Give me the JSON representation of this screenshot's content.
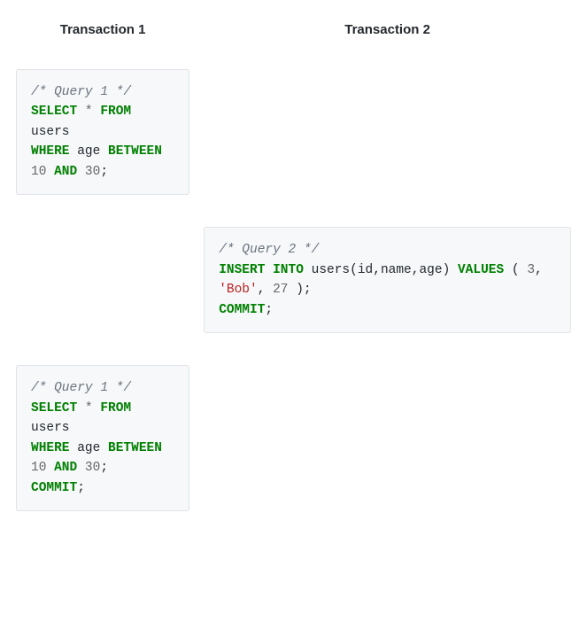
{
  "headers": {
    "col1": "Transaction 1",
    "col2": "Transaction 2"
  },
  "rows": [
    {
      "col1": {
        "tokens": [
          {
            "t": "/* Query 1 */",
            "c": "c-comment"
          },
          {
            "t": "\n"
          },
          {
            "t": "SELECT",
            "c": "c-keyword"
          },
          {
            "t": " "
          },
          {
            "t": "*",
            "c": "c-op"
          },
          {
            "t": " "
          },
          {
            "t": "FROM",
            "c": "c-keyword"
          },
          {
            "t": " "
          },
          {
            "t": "users",
            "c": "c-ident"
          },
          {
            "t": "\n"
          },
          {
            "t": "WHERE",
            "c": "c-keyword"
          },
          {
            "t": " "
          },
          {
            "t": "age",
            "c": "c-ident"
          },
          {
            "t": " "
          },
          {
            "t": "BETWEEN",
            "c": "c-keyword"
          },
          {
            "t": " "
          },
          {
            "t": "10",
            "c": "c-number"
          },
          {
            "t": " "
          },
          {
            "t": "AND",
            "c": "c-keyword"
          },
          {
            "t": " "
          },
          {
            "t": "30",
            "c": "c-number"
          },
          {
            "t": ";",
            "c": "c-punct"
          }
        ]
      },
      "col2": null
    },
    {
      "col1": null,
      "col2": {
        "tokens": [
          {
            "t": "/* Query 2 */",
            "c": "c-comment"
          },
          {
            "t": "\n"
          },
          {
            "t": "INSERT",
            "c": "c-keyword"
          },
          {
            "t": " "
          },
          {
            "t": "INTO",
            "c": "c-keyword"
          },
          {
            "t": " "
          },
          {
            "t": "users",
            "c": "c-ident"
          },
          {
            "t": "(",
            "c": "c-punct"
          },
          {
            "t": "id",
            "c": "c-ident"
          },
          {
            "t": ",",
            "c": "c-punct"
          },
          {
            "t": "name",
            "c": "c-ident"
          },
          {
            "t": ",",
            "c": "c-punct"
          },
          {
            "t": "age",
            "c": "c-ident"
          },
          {
            "t": ")",
            "c": "c-punct"
          },
          {
            "t": " "
          },
          {
            "t": "VALUES",
            "c": "c-keyword"
          },
          {
            "t": " "
          },
          {
            "t": "(",
            "c": "c-punct"
          },
          {
            "t": " "
          },
          {
            "t": "3",
            "c": "c-number"
          },
          {
            "t": ",",
            "c": "c-punct"
          },
          {
            "t": " "
          },
          {
            "t": "'Bob'",
            "c": "c-string"
          },
          {
            "t": ",",
            "c": "c-punct"
          },
          {
            "t": " "
          },
          {
            "t": "27",
            "c": "c-number"
          },
          {
            "t": " "
          },
          {
            "t": ");",
            "c": "c-punct"
          },
          {
            "t": "\n"
          },
          {
            "t": "COMMIT",
            "c": "c-keyword"
          },
          {
            "t": ";",
            "c": "c-punct"
          }
        ]
      }
    },
    {
      "col1": {
        "tokens": [
          {
            "t": "/* Query 1 */",
            "c": "c-comment"
          },
          {
            "t": "\n"
          },
          {
            "t": "SELECT",
            "c": "c-keyword"
          },
          {
            "t": " "
          },
          {
            "t": "*",
            "c": "c-op"
          },
          {
            "t": " "
          },
          {
            "t": "FROM",
            "c": "c-keyword"
          },
          {
            "t": " "
          },
          {
            "t": "users",
            "c": "c-ident"
          },
          {
            "t": "\n"
          },
          {
            "t": "WHERE",
            "c": "c-keyword"
          },
          {
            "t": " "
          },
          {
            "t": "age",
            "c": "c-ident"
          },
          {
            "t": " "
          },
          {
            "t": "BETWEEN",
            "c": "c-keyword"
          },
          {
            "t": " "
          },
          {
            "t": "10",
            "c": "c-number"
          },
          {
            "t": " "
          },
          {
            "t": "AND",
            "c": "c-keyword"
          },
          {
            "t": " "
          },
          {
            "t": "30",
            "c": "c-number"
          },
          {
            "t": ";",
            "c": "c-punct"
          },
          {
            "t": "\n"
          },
          {
            "t": "COMMIT",
            "c": "c-keyword"
          },
          {
            "t": ";",
            "c": "c-punct"
          }
        ]
      },
      "col2": null
    }
  ]
}
